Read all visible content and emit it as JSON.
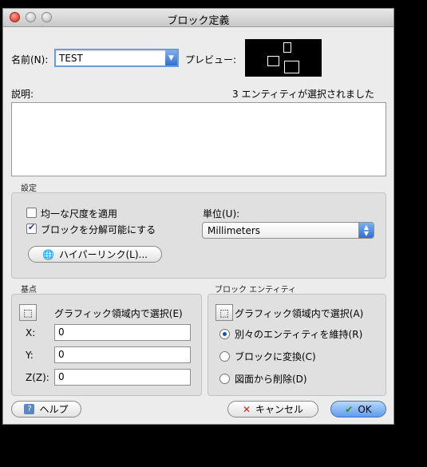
{
  "window": {
    "title": "ブロック定義"
  },
  "name": {
    "label": "名前(N):",
    "value": "TEST"
  },
  "preview": {
    "label": "プレビュー:"
  },
  "description": {
    "label": "説明:",
    "value": "",
    "selection_status": "3 エンティティが選択されました"
  },
  "settings": {
    "group_label": "設定",
    "uniform_scale_label": "均一な尺度を適用",
    "uniform_scale_checked": false,
    "allow_explode_label": "ブロックを分解可能にする",
    "allow_explode_checked": true,
    "units_label": "単位(U):",
    "units_value": "Millimeters",
    "hyperlink_label": "ハイパーリンク(L)..."
  },
  "base_point": {
    "group_label": "基点",
    "pick_label": "グラフィック領域内で選択(E)",
    "x_label": "X:",
    "x_value": "0",
    "y_label": "Y:",
    "y_value": "0",
    "z_label": "Z(Z):",
    "z_value": "0"
  },
  "block_entities": {
    "group_label": "ブロック エンティティ",
    "pick_label": "グラフィック領域内で選択(A)",
    "options": [
      {
        "label": "別々のエンティティを維持(R)",
        "selected": true
      },
      {
        "label": "ブロックに変換(C)",
        "selected": false
      },
      {
        "label": "図面から削除(D)",
        "selected": false
      }
    ]
  },
  "buttons": {
    "help": "ヘルプ",
    "cancel": "キャンセル",
    "ok": "OK"
  }
}
